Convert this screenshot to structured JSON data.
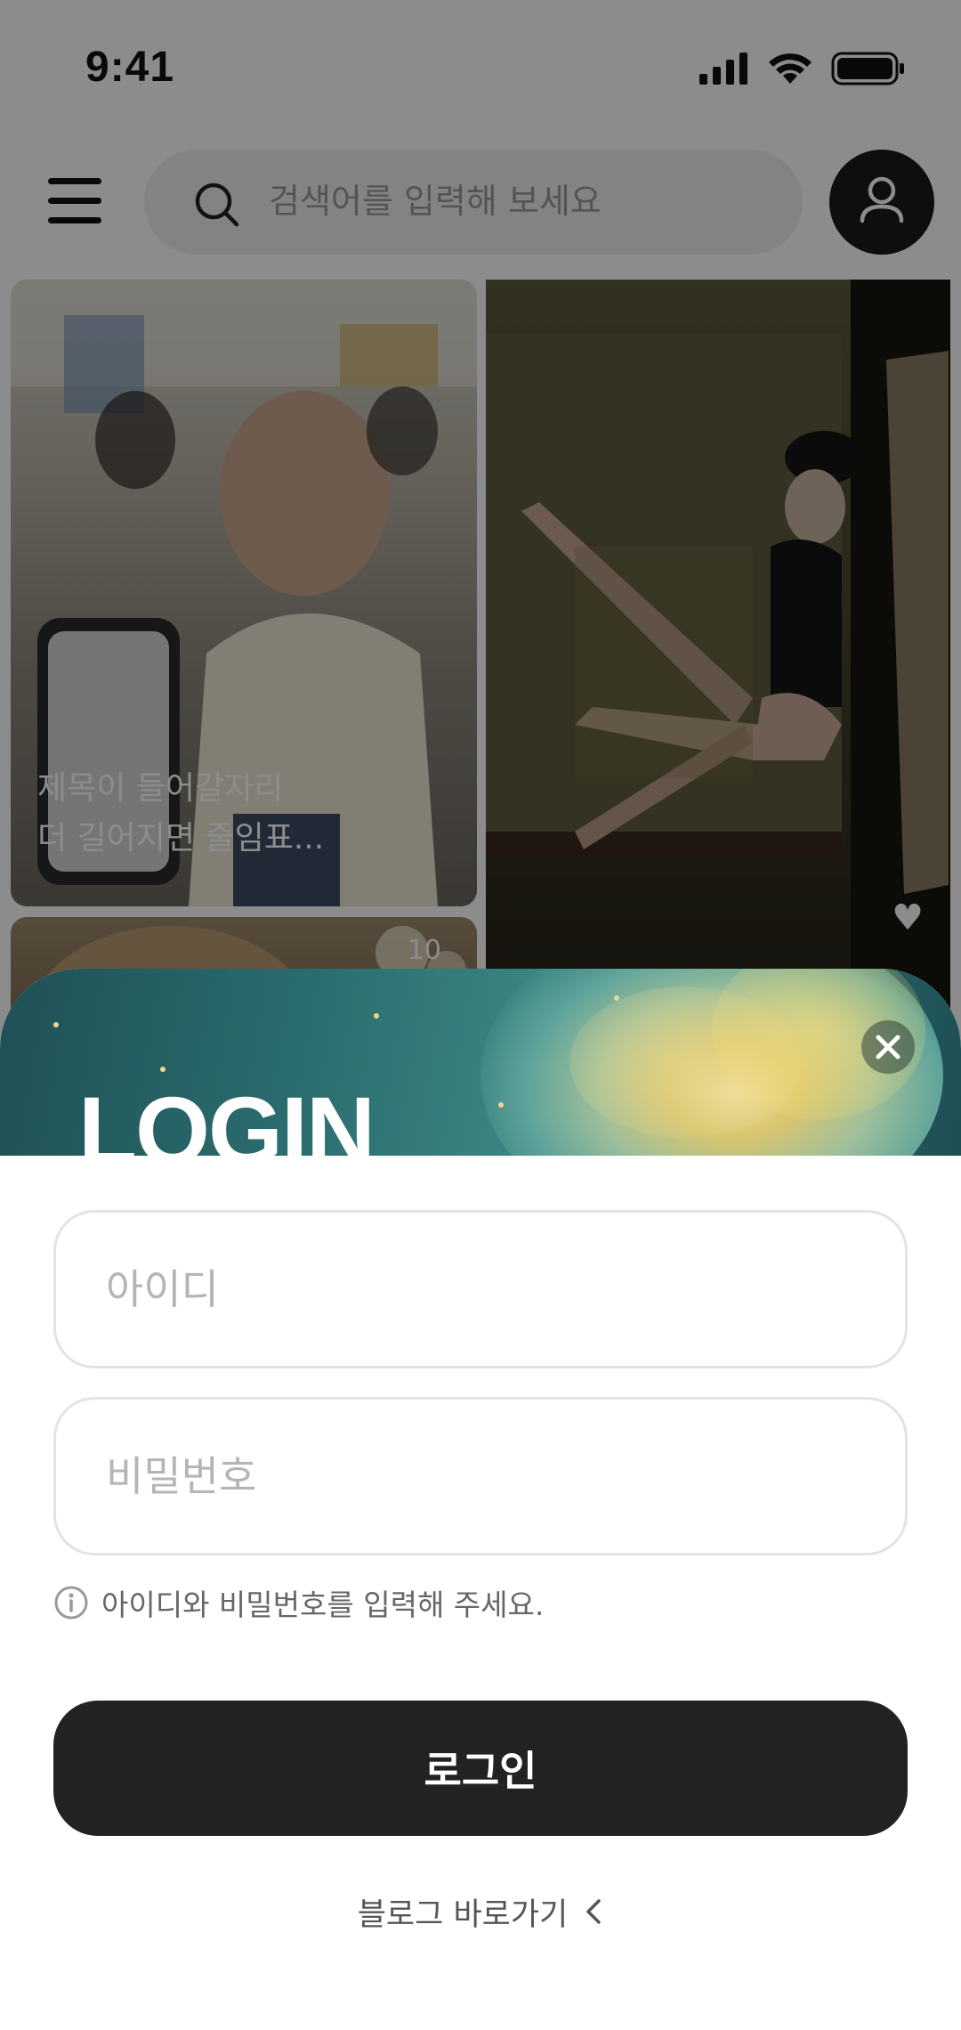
{
  "status_bar": {
    "time": "9:41"
  },
  "header": {
    "search_placeholder": "검색어를 입력해 보세요"
  },
  "feed": {
    "cards": [
      {
        "caption_line1": "제목이 들어갈자리",
        "caption_line2": "더 길어지면 줄임표..."
      },
      {
        "count": "10"
      }
    ]
  },
  "login": {
    "title": "LOGIN",
    "id_placeholder": "아이디",
    "password_placeholder": "비밀번호",
    "hint": "아이디와 비밀번호를 입력해 주세요.",
    "submit_label": "로그인",
    "blog_link": "블로그 바로가기"
  },
  "colors": {
    "button_dark": "#222124",
    "field_border": "#e3e3e3",
    "hint_text": "#666666"
  }
}
